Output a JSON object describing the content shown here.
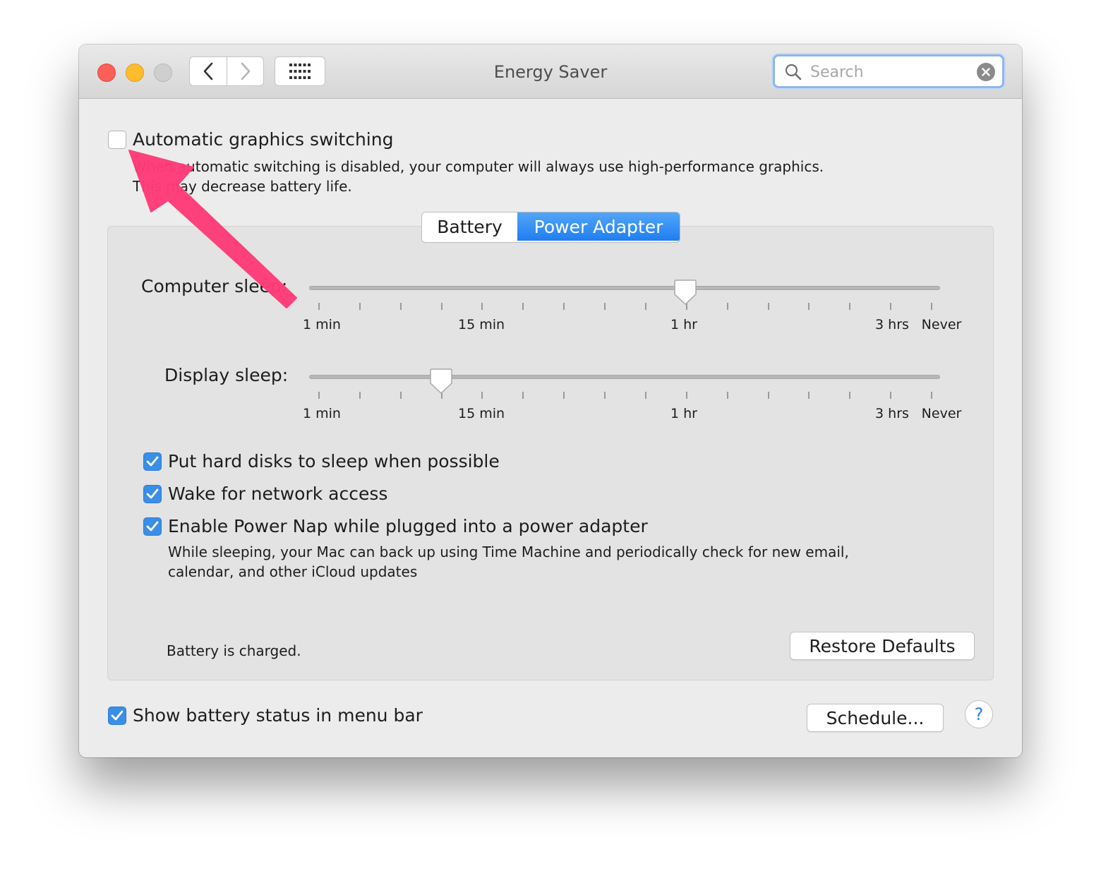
{
  "window": {
    "title": "Energy Saver"
  },
  "titlebar": {
    "traffic_lights": [
      "close",
      "minimize",
      "zoom"
    ],
    "nav": {
      "back_icon": "chevron-left-icon",
      "forward_icon": "chevron-right-icon",
      "grid_icon": "show-all-grid-icon"
    }
  },
  "search": {
    "placeholder": "Search",
    "value": ""
  },
  "graphics": {
    "checkbox_label": "Automatic graphics switching",
    "checked": false,
    "desc_line1": "When automatic switching is disabled, your computer will always use high-performance graphics.",
    "desc_line2": "This may decrease battery life."
  },
  "tabs": [
    {
      "label": "Battery",
      "selected": false
    },
    {
      "label": "Power Adapter",
      "selected": true
    }
  ],
  "sliders": {
    "computer_sleep": {
      "label": "Computer sleep:",
      "value": "1 hr"
    },
    "display_sleep": {
      "label": "Display sleep:",
      "value": "10 min"
    },
    "tick_labels": [
      "1 min",
      "15 min",
      "1 hr",
      "3 hrs",
      "Never"
    ]
  },
  "options": [
    {
      "label": "Put hard disks to sleep when possible",
      "checked": true
    },
    {
      "label": "Wake for network access",
      "checked": true
    },
    {
      "label": "Enable Power Nap while plugged into a power adapter",
      "checked": true
    }
  ],
  "power_nap_desc": {
    "line1": "While sleeping, your Mac can back up using Time Machine and periodically check for new email,",
    "line2": "calendar, and other iCloud updates"
  },
  "status": {
    "text": "Battery is charged."
  },
  "buttons": {
    "restore_defaults": "Restore Defaults",
    "schedule": "Schedule...",
    "help": "?"
  },
  "menu_bar_option": {
    "label": "Show battery status in menu bar",
    "checked": true
  },
  "colors": {
    "accent": "#3a8ee6",
    "annotation_arrow": "#ff3b7a"
  }
}
